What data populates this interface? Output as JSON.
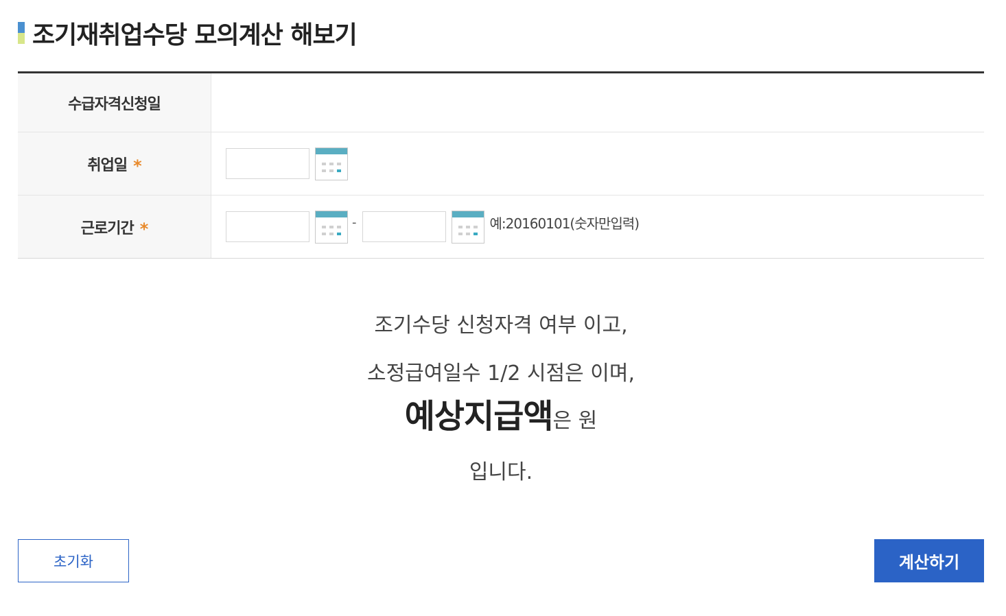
{
  "title": "조기재취업수당 모의계산 해보기",
  "colors": {
    "title_bar_top": "#4a90d0",
    "title_bar_bottom": "#d8e68a",
    "required_star": "#e88a2c",
    "calendar_header": "#5aaec2",
    "calendar_highlight": "#3aaac2",
    "primary_button": "#2b63c6",
    "reset_button_text": "#2b63c6",
    "reset_button_border": "#2b63c6"
  },
  "form": {
    "rows": [
      {
        "label": "수급자격신청일"
      },
      {
        "label": "취업일",
        "required_mark": "*",
        "input_value": ""
      },
      {
        "label": "근로기간",
        "required_mark": "*",
        "start_value": "",
        "range_separator": "-",
        "end_value": "",
        "hint": "예:20160101(숫자만입력)"
      }
    ]
  },
  "icons": {
    "calendar": "calendar-icon"
  },
  "result": {
    "line1": "조기수당 신청자격 여부 이고,",
    "line2": "소정급여일수 1/2 시점은 이며,",
    "line3_big": "예상지급액",
    "line3_suffix": "은 원",
    "line4": "입니다."
  },
  "buttons": {
    "reset_label": "초기화",
    "calculate_label": "계산하기"
  }
}
